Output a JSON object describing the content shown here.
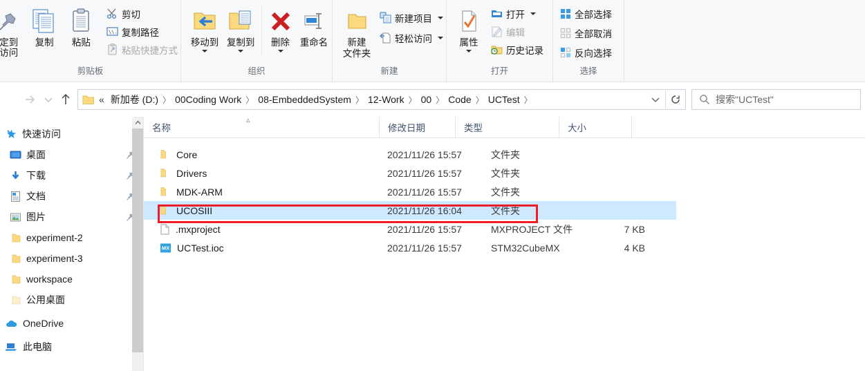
{
  "ribbon": {
    "groups": [
      {
        "name": "clipboard",
        "label": "剪贴板",
        "big_buttons": [
          {
            "label": "定到\n速访问",
            "label_line1": "定到",
            "label_line2": "访问",
            "icon": "pin-icon",
            "enabled": true
          },
          {
            "label": "复制",
            "icon": "copy-icon",
            "enabled": true
          },
          {
            "label": "粘贴",
            "icon": "paste-icon",
            "enabled": true
          }
        ],
        "small_buttons": [
          {
            "label": "剪切",
            "icon": "scissors-icon",
            "enabled": true
          },
          {
            "label": "复制路径",
            "icon": "copy-path-icon",
            "enabled": true
          },
          {
            "label": "粘贴快捷方式",
            "icon": "paste-shortcut-icon",
            "enabled": false
          }
        ]
      },
      {
        "name": "organize",
        "label": "组织",
        "big_buttons": [
          {
            "label": "移动到",
            "icon": "move-to-icon",
            "has_caret": true,
            "enabled": true
          },
          {
            "label": "复制到",
            "icon": "copy-to-icon",
            "has_caret": true,
            "enabled": true
          },
          {
            "label": "删除",
            "icon": "delete-icon",
            "has_caret": true,
            "enabled": true
          },
          {
            "label": "重命名",
            "icon": "rename-icon",
            "has_caret": false,
            "enabled": true
          }
        ],
        "small_buttons": []
      },
      {
        "name": "new",
        "label": "新建",
        "big_buttons": [
          {
            "label_line1": "新建",
            "label_line2": "文件夹",
            "icon": "new-folder-icon",
            "enabled": true
          }
        ],
        "small_buttons": [
          {
            "label": "新建项目",
            "icon": "new-item-icon",
            "has_caret": true,
            "enabled": true
          },
          {
            "label": "轻松访问",
            "icon": "easy-access-icon",
            "has_caret": true,
            "enabled": true
          }
        ]
      },
      {
        "name": "open",
        "label": "打开",
        "big_buttons": [
          {
            "label": "属性",
            "icon": "properties-icon",
            "has_caret": true,
            "enabled": true
          }
        ],
        "small_buttons": [
          {
            "label": "打开",
            "icon": "open-icon",
            "has_caret": true,
            "enabled": true
          },
          {
            "label": "编辑",
            "icon": "edit-icon",
            "has_caret": false,
            "enabled": false
          },
          {
            "label": "历史记录",
            "icon": "history-icon",
            "has_caret": false,
            "enabled": true
          }
        ]
      },
      {
        "name": "select",
        "label": "选择",
        "big_buttons": [],
        "small_buttons": [
          {
            "label": "全部选择",
            "icon": "select-all-icon",
            "enabled": true
          },
          {
            "label": "全部取消",
            "icon": "select-none-icon",
            "enabled": true
          },
          {
            "label": "反向选择",
            "icon": "invert-selection-icon",
            "enabled": true
          }
        ]
      }
    ]
  },
  "address_bar": {
    "back_icon": "arrow-left-icon",
    "forward_icon": "arrow-right-icon",
    "recent_icon": "chevron-down-icon",
    "up_icon": "arrow-up-icon",
    "folder_icon": "folder-icon",
    "overflow_label": "«",
    "breadcrumbs": [
      "新加卷 (D:)",
      "00Coding Work",
      "08-EmbeddedSystem",
      "12-Work",
      "00",
      "Code",
      "UCTest"
    ],
    "dropdown_icon": "chevron-down-icon",
    "refresh_icon": "refresh-icon",
    "search": {
      "icon": "search-icon",
      "value": "搜索\"UCTest\"",
      "placeholder": "搜索\"UCTest\""
    }
  },
  "sidebar": {
    "items": [
      {
        "label": "快速访问",
        "icon": "quick-access-star-icon",
        "pinned": false,
        "indent": false
      },
      {
        "label": "桌面",
        "icon": "desktop-icon",
        "pinned": true,
        "indent": true
      },
      {
        "label": "下载",
        "icon": "downloads-icon",
        "pinned": true,
        "indent": true
      },
      {
        "label": "文档",
        "icon": "documents-icon",
        "pinned": true,
        "indent": true
      },
      {
        "label": "图片",
        "icon": "pictures-icon",
        "pinned": true,
        "indent": true
      },
      {
        "label": "experiment-2",
        "icon": "folder-icon",
        "pinned": false,
        "indent": true
      },
      {
        "label": "experiment-3",
        "icon": "folder-icon",
        "pinned": false,
        "indent": true
      },
      {
        "label": "workspace",
        "icon": "folder-icon",
        "pinned": false,
        "indent": true
      },
      {
        "label": "公用桌面",
        "icon": "folder-icon",
        "pinned": false,
        "indent": true
      },
      {
        "label": "OneDrive",
        "icon": "onedrive-cloud-icon",
        "pinned": false,
        "indent": false
      },
      {
        "label": "此电脑",
        "icon": "this-pc-icon",
        "pinned": false,
        "indent": false
      }
    ]
  },
  "file_list": {
    "columns": [
      {
        "label": "名称",
        "sorted": true,
        "sort_dir": "asc"
      },
      {
        "label": "修改日期",
        "sorted": false
      },
      {
        "label": "类型",
        "sorted": false
      },
      {
        "label": "大小",
        "sorted": false
      }
    ],
    "rows": [
      {
        "name": "Core",
        "date": "2021/11/26 15:57",
        "type": "文件夹",
        "size": "",
        "icon": "folder-icon",
        "selected": false
      },
      {
        "name": "Drivers",
        "date": "2021/11/26 15:57",
        "type": "文件夹",
        "size": "",
        "icon": "folder-icon",
        "selected": false
      },
      {
        "name": "MDK-ARM",
        "date": "2021/11/26 15:57",
        "type": "文件夹",
        "size": "",
        "icon": "folder-icon",
        "selected": false
      },
      {
        "name": "UCOSIII",
        "date": "2021/11/26 16:04",
        "type": "文件夹",
        "size": "",
        "icon": "folder-icon",
        "selected": true
      },
      {
        "name": ".mxproject",
        "date": "2021/11/26 15:57",
        "type": "MXPROJECT 文件",
        "size": "7 KB",
        "icon": "generic-file-icon",
        "selected": false
      },
      {
        "name": "UCTest.ioc",
        "date": "2021/11/26 15:57",
        "type": "STM32CubeMX",
        "size": "4 KB",
        "icon": "cubemx-file-icon",
        "selected": false
      }
    ],
    "highlight": {
      "row_index": 3,
      "color": "#ee1c25"
    }
  },
  "colors": {
    "selection": "#cde8ff",
    "annotation": "#ee1c25",
    "ribbon_bg": "#f7f8f9",
    "header_text": "#44546f",
    "folder_yellow": "#ffd36b"
  }
}
